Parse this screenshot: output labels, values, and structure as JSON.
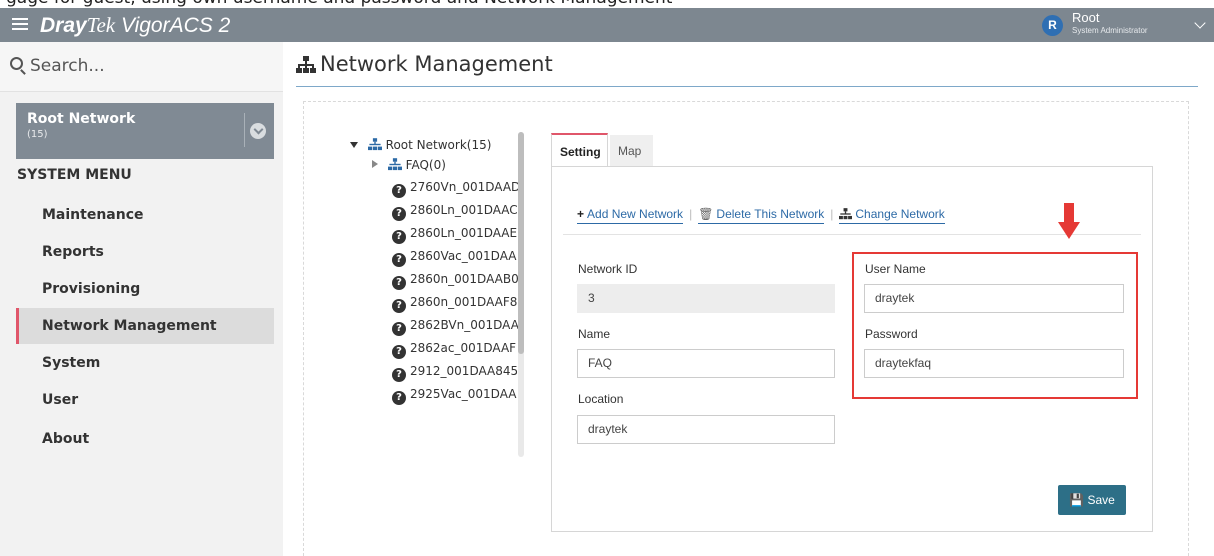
{
  "top_caption": "gage for guest, using own username and password and Network Management",
  "header": {
    "logo": {
      "part1": "Dray",
      "part2": "Tek",
      "part3": " VigorACS 2"
    },
    "avatar_letter": "R",
    "user_name": "Root",
    "user_role": "System Administrator"
  },
  "sidebar": {
    "search_placeholder": "Search...",
    "root_network": {
      "name": "Root Network",
      "count": "(15)"
    },
    "system_menu_label": "SYSTEM MENU",
    "items": [
      {
        "label": "Maintenance"
      },
      {
        "label": "Reports"
      },
      {
        "label": "Provisioning"
      },
      {
        "label": "Network Management"
      },
      {
        "label": "System"
      },
      {
        "label": "User"
      },
      {
        "label": "About"
      }
    ],
    "active_item": "Network Management"
  },
  "page": {
    "title": "Network Management"
  },
  "tree": {
    "root": "Root Network(15)",
    "folder": "FAQ(0)",
    "devices": [
      "2760Vn_001DAAD",
      "2860Ln_001DAAC",
      "2860Ln_001DAAE",
      "2860Vac_001DAA",
      "2860n_001DAAB0",
      "2860n_001DAAF8",
      "2862BVn_001DAA",
      "2862ac_001DAAF",
      "2912_001DAA845",
      "2925Vac_001DAA"
    ]
  },
  "tabs": [
    {
      "label": "Setting",
      "active": true
    },
    {
      "label": "Map",
      "active": false
    }
  ],
  "actions": {
    "add": "Add New Network",
    "delete": "Delete This Network",
    "change": "Change Network"
  },
  "form": {
    "network_id_label": "Network ID",
    "network_id_value": "3",
    "name_label": "Name",
    "name_value": "FAQ",
    "location_label": "Location",
    "location_value": "draytek",
    "username_label": "User Name",
    "username_value": "draytek",
    "password_label": "Password",
    "password_value": "draytekfaq"
  },
  "save_label": "Save",
  "colors": {
    "header_bg": "#7d8790",
    "accent_red": "#e53935",
    "active_marker": "#e0566a",
    "link_blue": "#2d6aa6",
    "save_bg": "#2d6f87"
  }
}
